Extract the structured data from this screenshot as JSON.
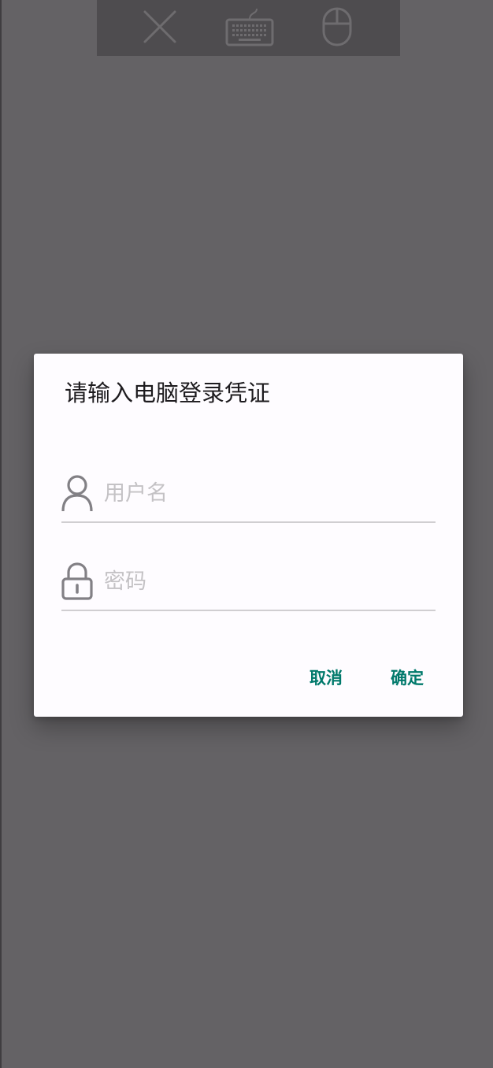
{
  "toolbar": {
    "icons": [
      "close-icon",
      "keyboard-icon",
      "mouse-icon"
    ]
  },
  "dialog": {
    "title": "请输入电脑登录凭证",
    "username": {
      "placeholder": "用户名",
      "value": "",
      "icon": "user-icon"
    },
    "password": {
      "placeholder": "密码",
      "value": "",
      "icon": "lock-icon"
    },
    "cancel_label": "取消",
    "confirm_label": "确定"
  },
  "colors": {
    "backdrop": "#646265",
    "toolbar": "#4e4c4f",
    "dialog_bg": "#fefcff",
    "accent": "#00796b",
    "placeholder": "#c4c2c5",
    "divider": "#d0ced1"
  }
}
